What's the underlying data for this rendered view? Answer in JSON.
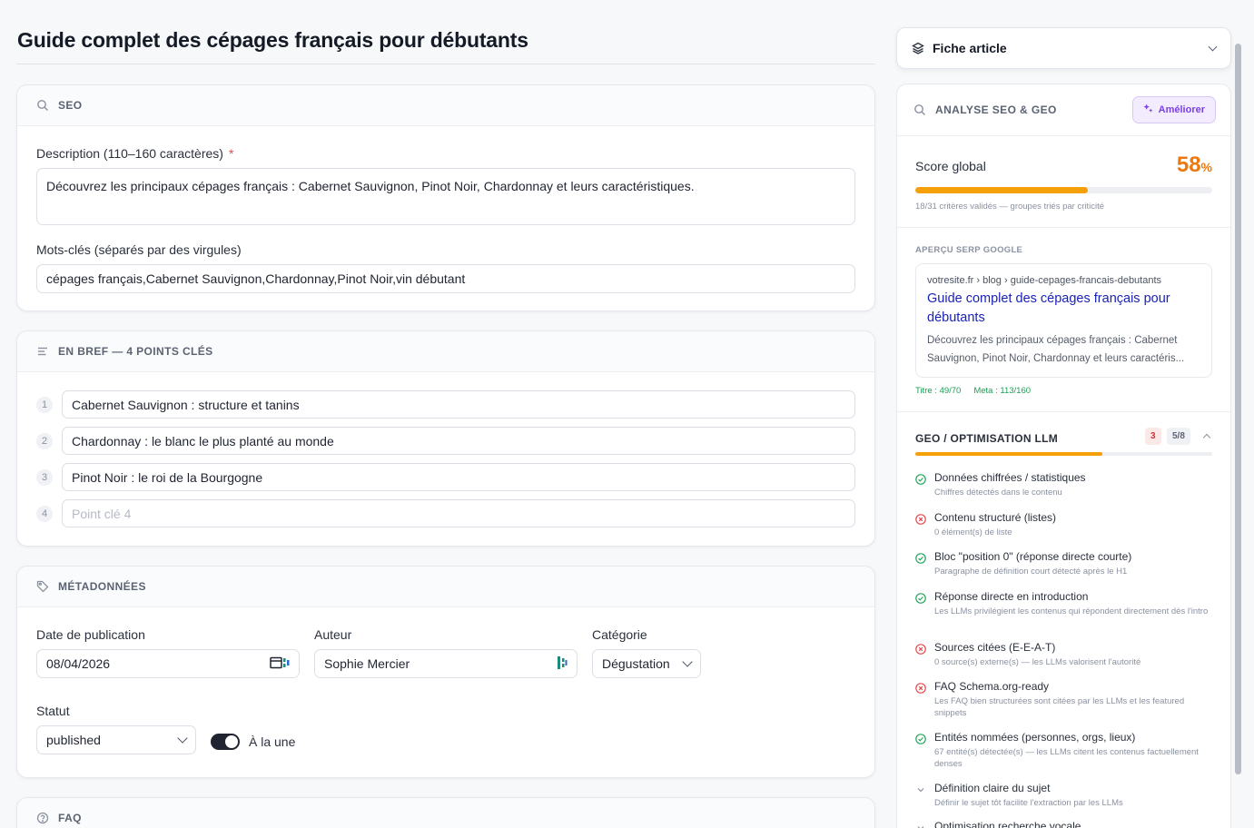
{
  "page": {
    "title": "Guide complet des cépages français pour débutants"
  },
  "seo": {
    "section_title": "SEO",
    "description_label": "Description (110–160 caractères)",
    "required_mark": "*",
    "description_value": "Découvrez les principaux cépages français : Cabernet Sauvignon, Pinot Noir, Chardonnay et leurs caractéristiques.",
    "keywords_label": "Mots-clés (séparés par des virgules)",
    "keywords_value": "cépages français,Cabernet Sauvignon,Chardonnay,Pinot Noir,vin débutant"
  },
  "brief": {
    "section_title": "EN BREF — 4 POINTS CLÉS",
    "points": [
      {
        "num": "1",
        "value": "Cabernet Sauvignon : structure et tanins",
        "placeholder": ""
      },
      {
        "num": "2",
        "value": "Chardonnay : le blanc le plus planté au monde",
        "placeholder": ""
      },
      {
        "num": "3",
        "value": "Pinot Noir : le roi de la Bourgogne",
        "placeholder": ""
      },
      {
        "num": "4",
        "value": "",
        "placeholder": "Point clé 4"
      }
    ]
  },
  "meta": {
    "section_title": "MÉTADONNÉES",
    "date_label": "Date de publication",
    "date_value": "08/04/2026",
    "author_label": "Auteur",
    "author_value": "Sophie Mercier",
    "category_label": "Catégorie",
    "category_value": "Dégustation",
    "status_label": "Statut",
    "status_value": "published",
    "featured_label": "À la une",
    "featured_on": true
  },
  "faq": {
    "section_title": "FAQ"
  },
  "sidebar": {
    "fiche_label": "Fiche article",
    "analysis_title": "ANALYSE SEO & GEO",
    "improve_label": "Améliorer",
    "score_label": "Score global",
    "score_value": "58",
    "score_unit": "%",
    "score_fraction": 0.58,
    "score_sub": "18/31 critères validés — groupes triés par criticité",
    "serp_label": "APERÇU SERP GOOGLE",
    "serp_url": "votresite.fr › blog › guide-cepages-francais-debutants",
    "serp_title": "Guide complet des cépages français pour débutants",
    "serp_desc": "Découvrez les principaux cépages français : Cabernet Sauvignon, Pinot Noir, Chardonnay et leurs caractéris...",
    "serp_title_count": "Titre : 49/70",
    "serp_meta_count": "Meta : 113/160",
    "geo_title": "GEO / OPTIMISATION LLM",
    "geo_fail_count": "3",
    "geo_pass_count": "5/8",
    "geo_fraction": 0.63,
    "criteria": [
      {
        "status": "pass",
        "title": "Données chiffrées / statistiques",
        "desc": "Chiffres détectés dans le contenu"
      },
      {
        "status": "fail",
        "title": "Contenu structuré (listes)",
        "desc": "0 élément(s) de liste"
      },
      {
        "status": "pass",
        "title": "Bloc \"position 0\" (réponse directe courte)",
        "desc": "Paragraphe de définition court détecté après le H1"
      },
      {
        "status": "pass",
        "title": "Réponse directe en introduction",
        "desc": "Les LLMs privilégient les contenus qui répondent directement dès l'intro"
      },
      {
        "status": "fail",
        "title": "Sources citées (E-E-A-T)",
        "desc": "0 source(s) externe(s) — les LLMs valorisent l'autorité"
      },
      {
        "status": "fail",
        "title": "FAQ Schema.org-ready",
        "desc": "Les FAQ bien structurées sont citées par les LLMs et les featured snippets"
      },
      {
        "status": "pass",
        "title": "Entités nommées (personnes, orgs, lieux)",
        "desc": "67 entité(s) détectée(s) — les LLMs citent les contenus factuellement denses"
      },
      {
        "status": "pending",
        "title": "Définition claire du sujet",
        "desc": "Définir le sujet tôt facilite l'extraction par les LLMs"
      },
      {
        "status": "pending",
        "title": "Optimisation recherche vocale",
        "desc": ""
      }
    ]
  },
  "colors": {
    "accent": "#ea7a10",
    "bar": "#f5a009",
    "pass": "#22a55b",
    "fail": "#e5484d",
    "link": "#1a22b8",
    "improve": "#7b3fe4"
  }
}
